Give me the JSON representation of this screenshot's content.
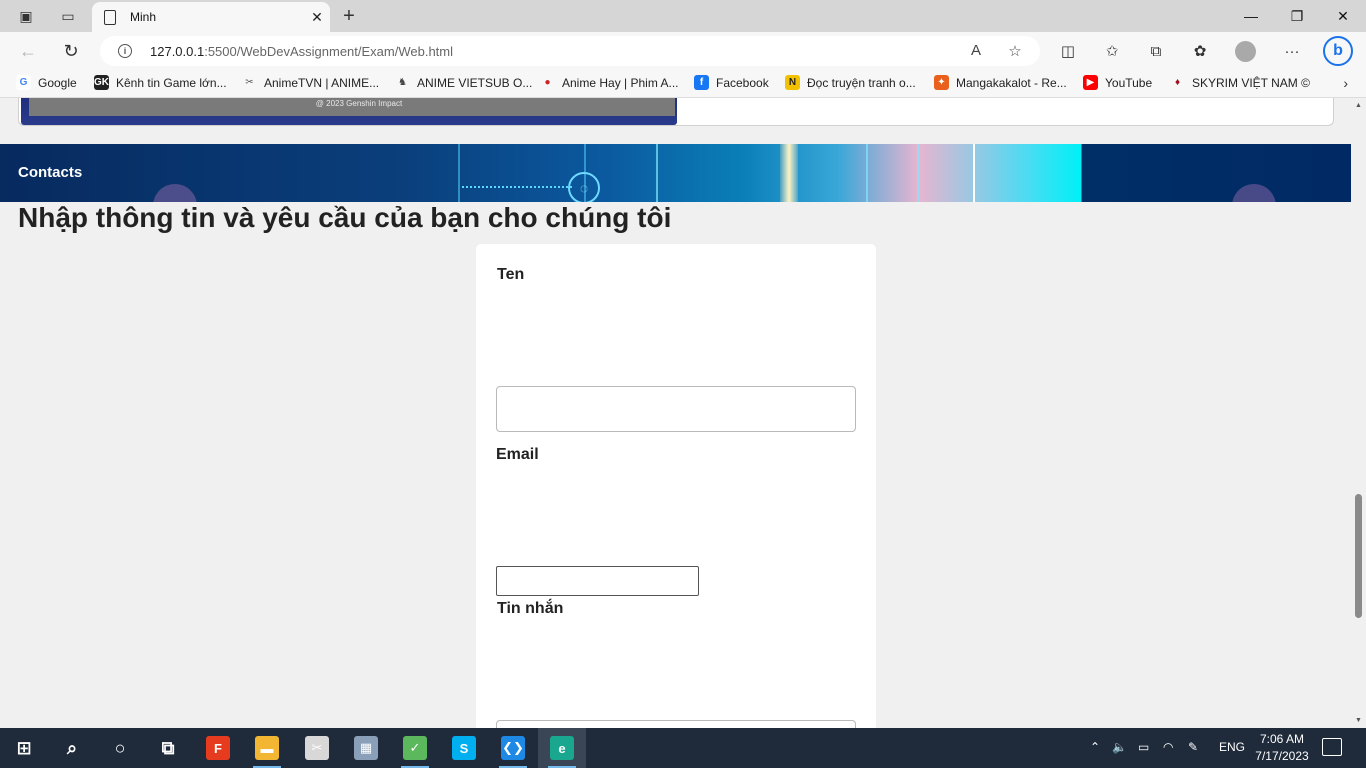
{
  "browser": {
    "tab_title": "Minh",
    "url_host": "127.0.0.1",
    "url_rest": ":5500/WebDevAssignment/Exam/Web.html",
    "icons": {
      "workspaces": "▣",
      "tab_actions": "▭",
      "close_tab": "✕",
      "new_tab": "+",
      "minimize": "—",
      "restore": "❐",
      "close_window": "✕",
      "back": "←",
      "refresh": "↻",
      "read_aloud": "A",
      "favorite": "☆",
      "split": "◫",
      "favorites": "✩",
      "collections": "⧉",
      "performance": "✿",
      "more": "···",
      "bing": "b"
    }
  },
  "bookmarks": [
    {
      "label": "Google",
      "fav": "G",
      "color": "#ffffff",
      "text": "#4285f4"
    },
    {
      "label": "Kênh tin Game lớn...",
      "fav": "GK",
      "color": "#222222",
      "text": "#ffffff"
    },
    {
      "label": "AnimeTVN | ANIME...",
      "fav": "✂",
      "color": "#f7f7f7",
      "text": "#555555"
    },
    {
      "label": "ANIME VIETSUB O...",
      "fav": "♞",
      "color": "#f7f7f7",
      "text": "#444444"
    },
    {
      "label": "Anime Hay | Phim A...",
      "fav": "●",
      "color": "#f7f7f7",
      "text": "#cc2222"
    },
    {
      "label": "Facebook",
      "fav": "f",
      "color": "#1877f2",
      "text": "#ffffff"
    },
    {
      "label": "Đọc truyện tranh o...",
      "fav": "N",
      "color": "#f2c200",
      "text": "#222222"
    },
    {
      "label": "Mangakakalot - Re...",
      "fav": "✦",
      "color": "#e8601c",
      "text": "#ffffff"
    },
    {
      "label": "YouTube",
      "fav": "▶",
      "color": "#ff0000",
      "text": "#ffffff"
    },
    {
      "label": "SKYRIM VIỆT NAM ©",
      "fav": "♦",
      "color": "#f7f7f7",
      "text": "#a01020"
    }
  ],
  "page": {
    "banner_copyright": "@ 2023 Genshin Impact",
    "contacts_title": "Contacts",
    "chat_icon": "💬",
    "heading": "Nhập thông tin và yêu cầu của bạn cho chúng tôi",
    "form": {
      "name_label": "Ten",
      "email_label": "Email",
      "message_label": "Tin nhắn"
    }
  },
  "taskbar": {
    "apps": [
      {
        "name": "start",
        "glyph": "⊞",
        "color": "transparent"
      },
      {
        "name": "search",
        "glyph": "⌕",
        "color": "transparent"
      },
      {
        "name": "cortana",
        "glyph": "○",
        "color": "transparent"
      },
      {
        "name": "task-view",
        "glyph": "⧉",
        "color": "transparent"
      },
      {
        "name": "foxit",
        "glyph": "F",
        "color": "#e63b1f"
      },
      {
        "name": "file-explorer",
        "glyph": "▬",
        "color": "#f2b632"
      },
      {
        "name": "snipping",
        "glyph": "✂",
        "color": "#d8d8d8"
      },
      {
        "name": "photos",
        "glyph": "▦",
        "color": "#8aa0b8"
      },
      {
        "name": "coc-coc",
        "glyph": "✓",
        "color": "#5cb85c"
      },
      {
        "name": "skype",
        "glyph": "S",
        "color": "#00aff0"
      },
      {
        "name": "vscode",
        "glyph": "❮❯",
        "color": "#1e88e5"
      },
      {
        "name": "edge",
        "glyph": "e",
        "color": "#1aa78f"
      }
    ],
    "tray_lang": "ENG",
    "time": "7:06 AM",
    "date": "7/17/2023"
  }
}
